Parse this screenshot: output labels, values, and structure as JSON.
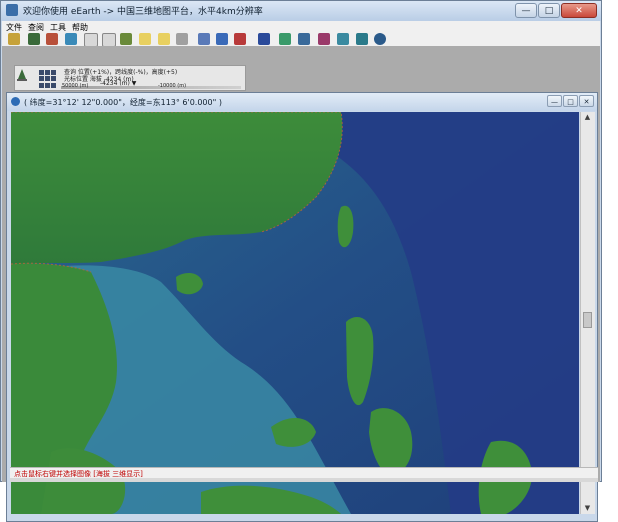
{
  "window": {
    "title": "欢迎你使用 eEarth -> 中国三维地图平台，水平4km分辨率",
    "controls": [
      "—",
      "□",
      "✕"
    ]
  },
  "menu": [
    "文件",
    "查阅",
    "工具",
    "帮助"
  ],
  "toolbar": {
    "icons": [
      "globe-icon",
      "binoculars-icon",
      "house-icon",
      "measure-icon",
      "zoom-in-icon",
      "zoom-out-icon",
      "location-icon",
      "document-icon",
      "copy-icon",
      "print-icon",
      "profile-icon",
      "diagonal-tool-icon",
      "axis-tool-icon",
      "terrain-icon",
      "layer-icon",
      "flow-icon",
      "shape-icon",
      "view3d-icon",
      "cylinder-icon",
      "sphere-icon"
    ]
  },
  "child_window": {
    "title": "( 纬度=31°12' 12\"0.000\"，经度=东113° 6'0.000\" )",
    "controls": [
      "—",
      "□",
      "✕"
    ]
  },
  "info_panel": {
    "line1": "查询 位置(+1%)，跨线度(-%)，高度(+5)",
    "line2": "光标位置 海拔 -4234 (m)",
    "line3": "-4234 (m) ▼",
    "scale_left": "50000 (m)",
    "scale_right": "-10000 (m)"
  },
  "status": {
    "text": "点击鼠标右键并选择图像 [海拔 三维显示]"
  },
  "colors": {
    "title_bar": "#c4d5ea",
    "status_text": "#c00000",
    "ocean_deep": "#1f3f7a",
    "ocean_shelf": "#3f8fa8",
    "land_green": "#2f8a3a"
  }
}
